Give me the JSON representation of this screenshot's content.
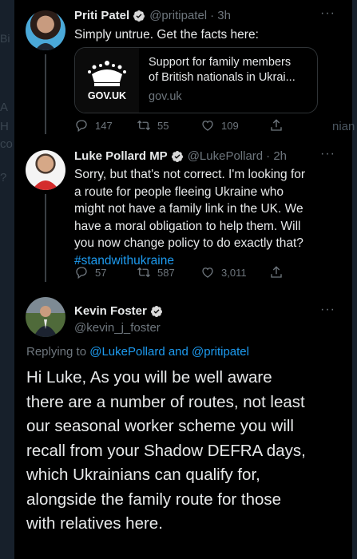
{
  "background": {
    "ghost_texts": [
      "Bi",
      "A",
      "H",
      "co",
      "?",
      "nian"
    ]
  },
  "tweets": [
    {
      "name": "Priti Patel",
      "handle": "@pritipatel",
      "time": "· 3h",
      "text": "Simply untrue. Get the facts here:",
      "card": {
        "brand": "GOV.UK",
        "title_line1": "Support for family members",
        "title_line2": "of British nationals in Ukrai...",
        "domain": "gov.uk"
      },
      "replies": "147",
      "retweets": "55",
      "likes": "109"
    },
    {
      "name": "Luke Pollard MP",
      "handle": "@LukePollard",
      "time": "· 2h",
      "lines": [
        "Sorry, but that's not correct. I'm looking for",
        "a route for people fleeing Ukraine who",
        "might not have a family link in the UK. We",
        "have a moral obligation to help them. Will",
        "you now change policy to do exactly that?"
      ],
      "hashtag": "#standwithukraine",
      "replies": "57",
      "retweets": "587",
      "likes": "3,011"
    },
    {
      "name": "Kevin Foster",
      "handle": "@kevin_j_foster",
      "replying_prefix": "Replying to",
      "replying_mention1": "@LukePollard",
      "replying_and": "and",
      "replying_mention2": "@pritipatel",
      "lines": [
        "Hi Luke, As you will be well aware",
        "there are a number of routes, not least",
        "our seasonal worker scheme you will",
        "recall from your Shadow DEFRA days,",
        "which Ukrainians can qualify for,",
        "alongside the family route for those",
        "with relatives here."
      ]
    }
  ],
  "more_glyph": "···",
  "colors": {
    "accent": "#1d9bf0",
    "verified": "#d9d9d9",
    "muted": "#6e767d"
  }
}
